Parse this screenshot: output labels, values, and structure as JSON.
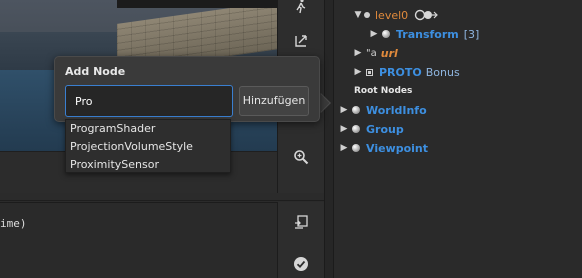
{
  "console": {
    "text": "ime)"
  },
  "scene_tree": {
    "level0": {
      "label": "level0"
    },
    "transform": {
      "label": "Transform",
      "count": "[3]"
    },
    "url": {
      "prefix": "\"a",
      "label": "url"
    },
    "proto": {
      "label": "PROTO",
      "suffix": "Bonus"
    },
    "root_nodes_label": "Root Nodes",
    "root_nodes": [
      {
        "label": "WorldInfo"
      },
      {
        "label": "Group"
      },
      {
        "label": "Viewpoint"
      }
    ]
  },
  "add_node": {
    "title": "Add Node",
    "search_value": "Pro",
    "add_button": "Hinzufügen",
    "suggestions": [
      "ProgramShader",
      "ProjectionVolumeStyle",
      "ProximitySensor"
    ]
  },
  "icons": {
    "walk": "walk-icon",
    "pick": "pick-icon",
    "zoom": "zoom-icon",
    "export": "export-icon",
    "check": "check-icon"
  },
  "colors": {
    "accent_blue": "#3d8fe0",
    "focus_border": "#3a7fd0",
    "orange": "#e08a3c"
  }
}
